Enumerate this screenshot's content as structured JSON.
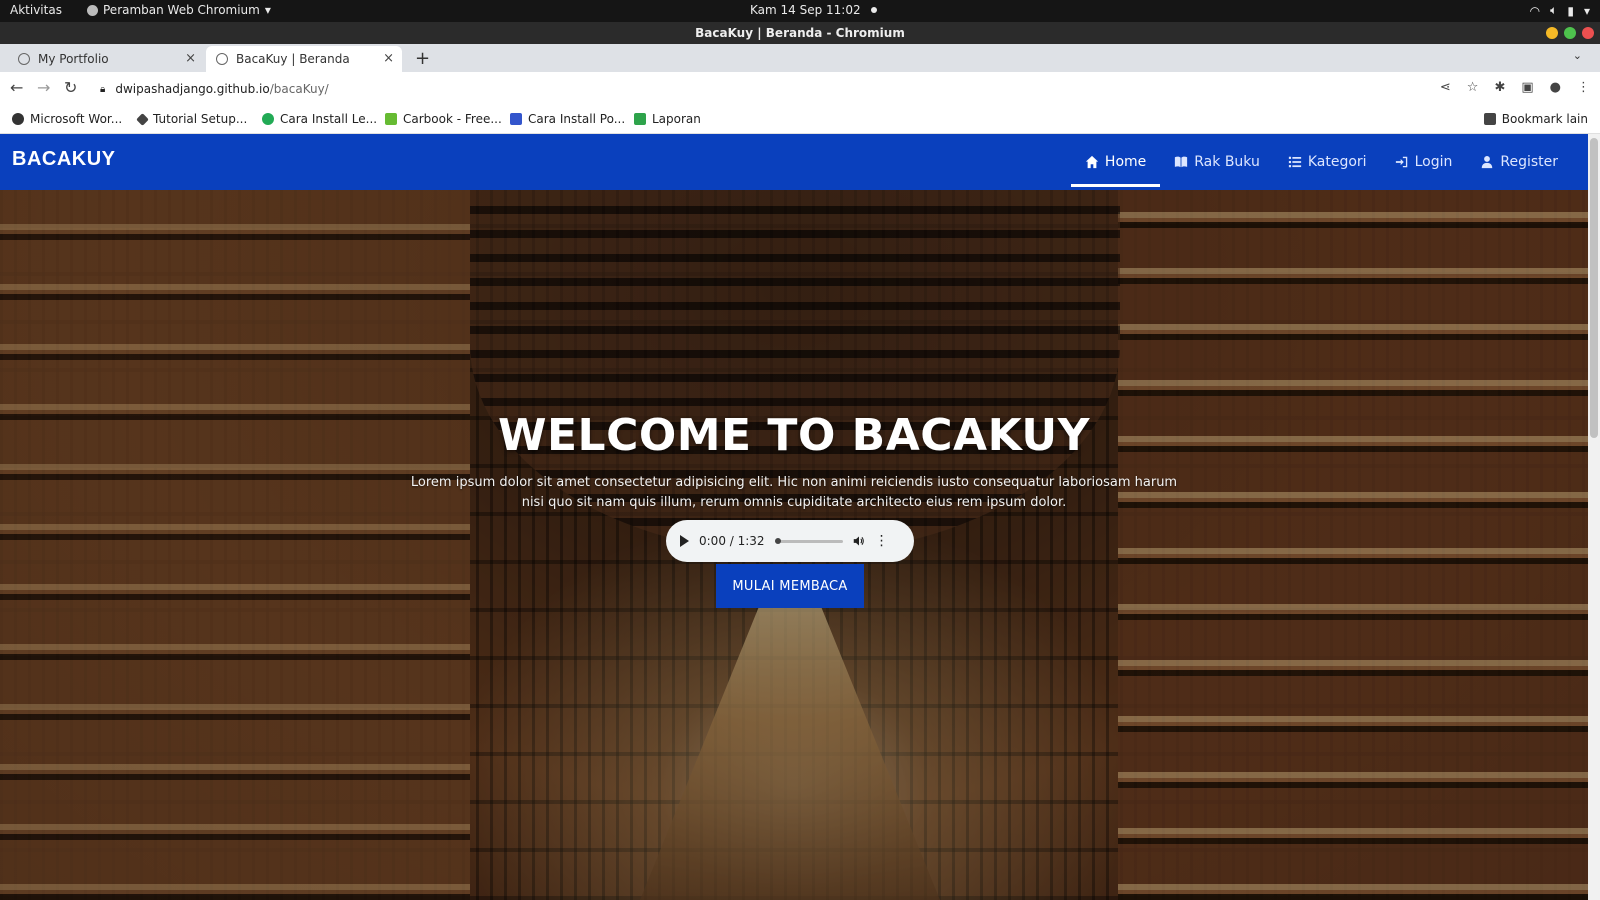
{
  "os": {
    "activities": "Aktivitas",
    "app_menu": "Peramban Web Chromium",
    "clock": "Kam 14 Sep  11:02"
  },
  "window": {
    "title": "BacaKuy | Beranda - Chromium",
    "controls": {
      "minimize": "#f5b926",
      "maximize": "#4ec24d",
      "close": "#ec5050"
    }
  },
  "tabs": [
    {
      "title": "My Portfolio",
      "close": "×"
    },
    {
      "title": "BacaKuy | Beranda",
      "close": "×"
    }
  ],
  "new_tab": "+",
  "tab_menu": "⌄",
  "address": {
    "host": "dwipashadjango.github.io",
    "path": "/bacaKuy/"
  },
  "bookmarks": {
    "items": [
      {
        "label": "Microsoft Wor...",
        "color": "#333333"
      },
      {
        "label": "Tutorial Setup...",
        "color": "#444444"
      },
      {
        "label": "Cara Install Le...",
        "color": "#22aa55"
      },
      {
        "label": "Carbook - Free...",
        "color": "#66bb33"
      },
      {
        "label": "Cara Install Po...",
        "color": "#3355cc"
      },
      {
        "label": "Laporan",
        "color": "#2ea34b"
      }
    ],
    "other": "Bookmark lain"
  },
  "site": {
    "brand": "BACAKUY",
    "brand_color": "#0a40bd",
    "nav": [
      {
        "label": "Home",
        "icon": "home-icon",
        "active": true
      },
      {
        "label": "Rak Buku",
        "icon": "book-icon",
        "active": false
      },
      {
        "label": "Kategori",
        "icon": "list-icon",
        "active": false
      },
      {
        "label": "Login",
        "icon": "login-icon",
        "active": false
      },
      {
        "label": "Register",
        "icon": "user-icon",
        "active": false
      }
    ],
    "hero": {
      "title": "WELCOME TO BACAKUY",
      "description": "Lorem ipsum dolor sit amet consectetur adipisicing elit. Hic non animi reiciendis iusto consequatur laboriosam harum nisi quo sit nam quis illum, rerum omnis cupiditate architecto eius rem ipsum dolor.",
      "audio_time": "0:00 / 1:32",
      "audio_progress": 0,
      "cta": "MULAI MEMBACA"
    }
  }
}
